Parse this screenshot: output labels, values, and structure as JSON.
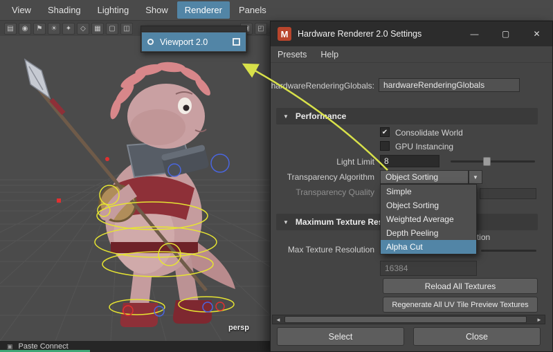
{
  "colors": {
    "accent": "#5285a6",
    "arrow": "#d8e14a"
  },
  "glyphs": {
    "check": "✔",
    "collapse": "▼",
    "dropdown_arrow": "▼",
    "scroll_left": "◄",
    "scroll_right": "►",
    "minimize": "—",
    "maximize": "▢",
    "close": "✕",
    "app_icon": "M",
    "clipboard": "▣"
  },
  "menubar": {
    "items": [
      "View",
      "Shading",
      "Lighting",
      "Show",
      "Renderer",
      "Panels"
    ],
    "active": "Renderer"
  },
  "toolbar": {
    "icons": [
      {
        "name": "film-icon",
        "glyph": "▤"
      },
      {
        "name": "camera-icon",
        "glyph": "◉"
      },
      {
        "name": "bookmark-icon",
        "glyph": "⚑"
      },
      {
        "name": "light-icon",
        "glyph": "☀"
      },
      {
        "name": "move-tool-icon",
        "glyph": "✦"
      },
      {
        "name": "snap-icon",
        "glyph": "◇"
      },
      {
        "name": "grid-toggle-icon",
        "glyph": "▦"
      },
      {
        "name": "single-pane-icon",
        "glyph": "▢"
      },
      {
        "name": "split-pane-icon",
        "glyph": "◫"
      },
      {
        "name": "shaded-cube-icon",
        "glyph": "▣"
      },
      {
        "name": "wireframe-cube-icon",
        "glyph": "◰"
      }
    ]
  },
  "renderer_menu": {
    "selected_item": "Viewport 2.0"
  },
  "viewport": {
    "camera_label": "persp"
  },
  "statusbar": {
    "text": "Paste Connect"
  },
  "dialog": {
    "title": "Hardware Renderer 2.0 Settings",
    "menus": [
      "Presets",
      "Help"
    ],
    "globals": {
      "label": "hardwareRenderingGlobals:",
      "value": "hardwareRenderingGlobals"
    },
    "performance_section": {
      "title": "Performance"
    },
    "consolidate_world": {
      "label": "Consolidate World",
      "checked": true
    },
    "gpu_instancing": {
      "label": "GPU Instancing",
      "checked": false
    },
    "light_limit": {
      "label": "Light Limit",
      "value": "8"
    },
    "transparency_algorithm": {
      "label": "Transparency Algorithm",
      "value": "Object Sorting"
    },
    "transparency_quality": {
      "label": "Transparency Quality"
    },
    "dropdown_options": [
      "Simple",
      "Object Sorting",
      "Weighted Average",
      "Depth Peeling",
      "Alpha Cut"
    ],
    "dropdown_highlighted": "Alpha Cut",
    "max_texture_section": {
      "title": "Maximum Texture Resolution"
    },
    "clamp_texture": {
      "label": "Clamp Texture Resolution"
    },
    "max_texture_resolution": {
      "label": "Max Texture Resolution",
      "value": "16384"
    },
    "buttons": {
      "reload": "Reload All Textures",
      "regenerate": "Regenerate All UV Tile Preview Textures",
      "select": "Select",
      "close": "Close"
    }
  }
}
